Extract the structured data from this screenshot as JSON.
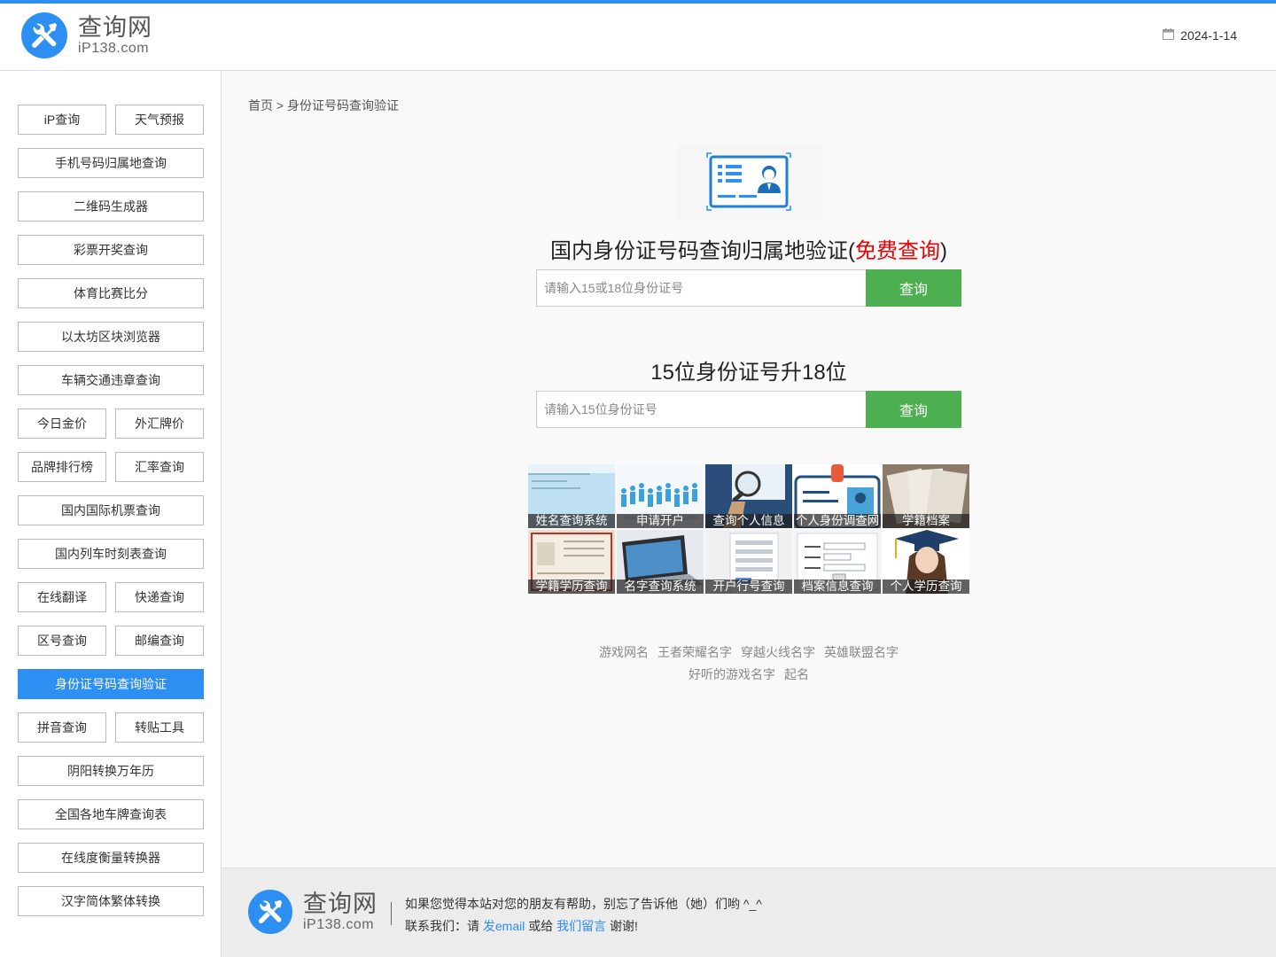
{
  "header": {
    "logo_cn": "查询网",
    "logo_en": "iP138.com",
    "date": "2024-1-14"
  },
  "sidebar": {
    "rows": [
      [
        "iP查询",
        "天气预报"
      ],
      [
        "手机号码归属地查询"
      ],
      [
        "二维码生成器"
      ],
      [
        "彩票开奖查询"
      ],
      [
        "体育比赛比分"
      ],
      [
        "以太坊区块浏览器"
      ],
      [
        "车辆交通违章查询"
      ],
      [
        "今日金价",
        "外汇牌价"
      ],
      [
        "品牌排行榜",
        "汇率查询"
      ],
      [
        "国内国际机票查询"
      ],
      [
        "国内列车时刻表查询"
      ],
      [
        "在线翻译",
        "快递查询"
      ],
      [
        "区号查询",
        "邮编查询"
      ],
      [
        "身份证号码查询验证"
      ],
      [
        "拼音查询",
        "转贴工具"
      ],
      [
        "阴阳转换万年历"
      ],
      [
        "全国各地车牌查询表"
      ],
      [
        "在线度衡量转换器"
      ],
      [
        "汉字简体繁体转换"
      ]
    ],
    "active": "身份证号码查询验证"
  },
  "main": {
    "breadcrumb": "首页 > 身份证号码查询验证",
    "title1_main": "国内身份证号码查询归属地验证(",
    "title1_red": "免费查询",
    "title1_end": ")",
    "search1": {
      "placeholder": "请输入15或18位身份证号",
      "button": "查询"
    },
    "title2": "15位身份证号升18位",
    "search2": {
      "placeholder": "请输入15位身份证号",
      "button": "查询"
    },
    "tiles": [
      "姓名查询系统",
      "申请开户",
      "查询个人信息",
      "个人身份调查网",
      "学籍档案",
      "学籍学历查询",
      "名字查询系统",
      "开户行号查询",
      "档案信息查询",
      "个人学历查询"
    ],
    "links_row1": [
      "游戏网名",
      "王者荣耀名字",
      "穿越火线名字",
      "英雄联盟名字"
    ],
    "links_row2": [
      "好听的游戏名字",
      "起名"
    ]
  },
  "footer": {
    "logo_cn": "查询网",
    "logo_en": "iP138.com",
    "line1": "如果您觉得本站对您的朋友有帮助，别忘了告诉他（她）们哟 ^_^",
    "line2_a": "联系我们：请",
    "email_link": "发email",
    "line2_b": "或给",
    "message_link": "我们留言",
    "line2_c": "谢谢!"
  },
  "colors": {
    "accent": "#2c8ff1",
    "button_green": "#4cb050",
    "highlight_red": "#ee0000"
  }
}
